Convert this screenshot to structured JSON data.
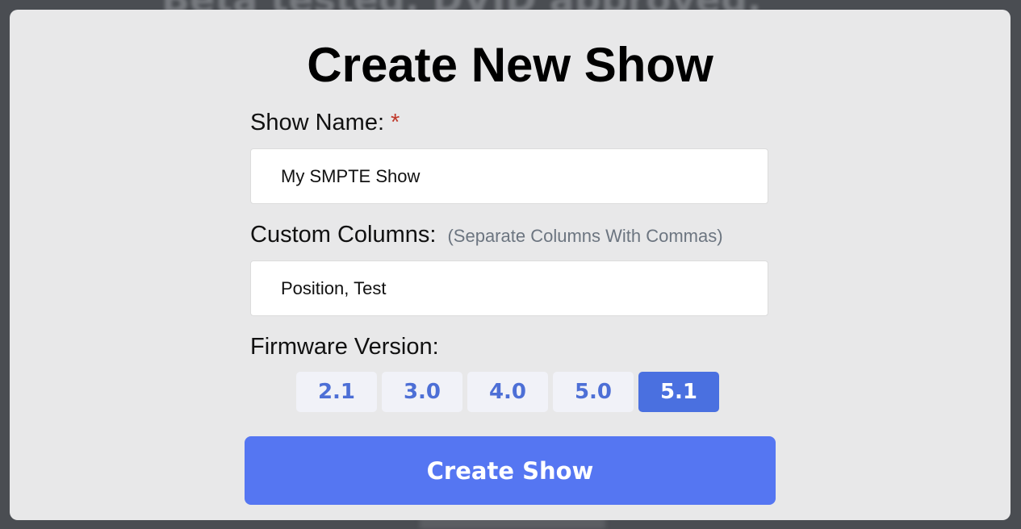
{
  "backdrop": {
    "text": "Beta tested. DVID approved."
  },
  "modal": {
    "title": "Create New Show"
  },
  "show_name": {
    "label": "Show Name:",
    "required_mark": "*",
    "value": "My SMPTE Show"
  },
  "custom_columns": {
    "label": "Custom Columns:",
    "hint": "(Separate Columns With Commas)",
    "value": "Position, Test"
  },
  "firmware": {
    "label": "Firmware Version:",
    "options": [
      "2.1",
      "3.0",
      "4.0",
      "5.0",
      "5.1"
    ],
    "selected": "5.1"
  },
  "submit": {
    "label": "Create Show"
  },
  "colors": {
    "primary_button": "#5576f2",
    "selected_version": "#4a70e0",
    "version_text": "#4d6fd6",
    "required": "#c0392b"
  }
}
